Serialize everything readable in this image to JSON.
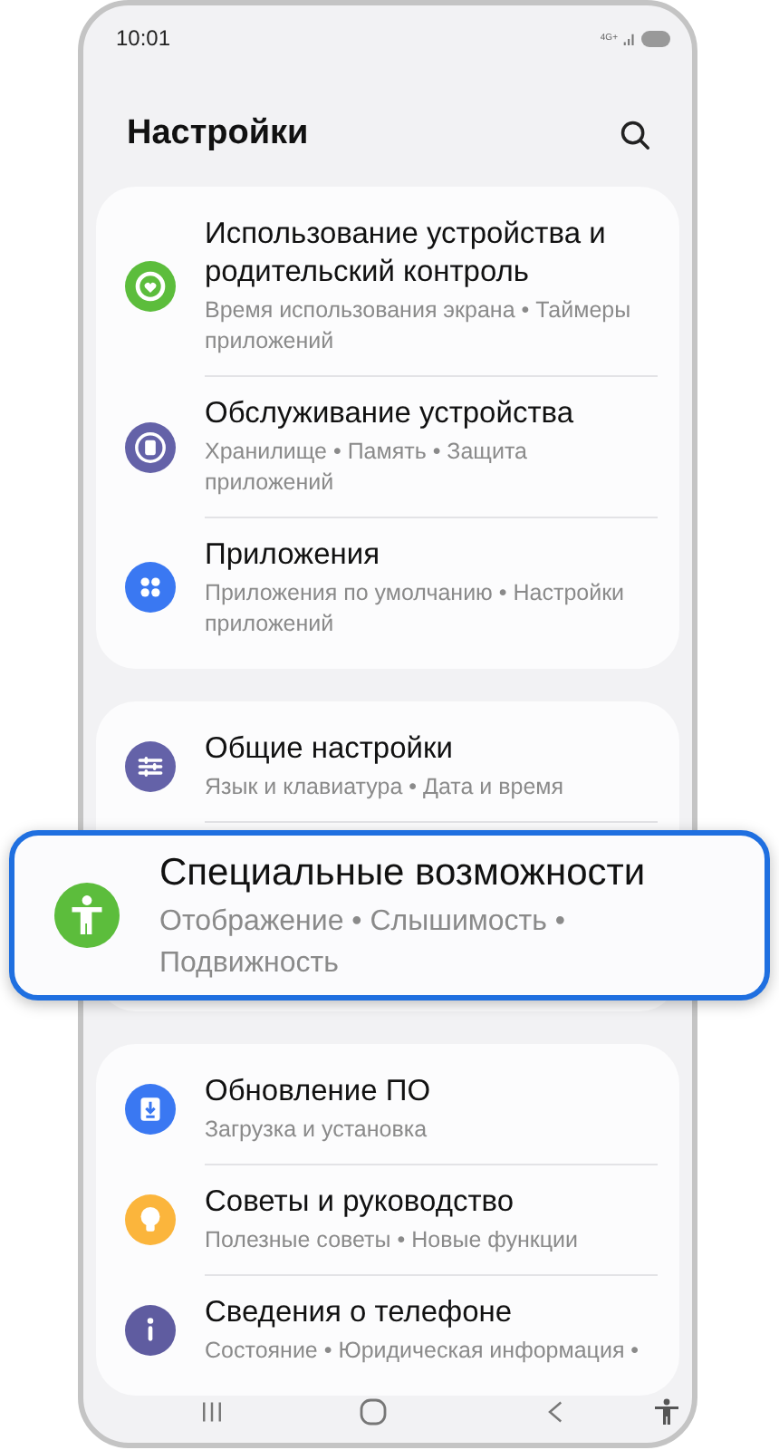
{
  "status_bar": {
    "time": "10:01",
    "network": "4G+"
  },
  "header": {
    "title": "Настройки"
  },
  "groups": [
    {
      "items": [
        {
          "title": "Использование устройства и родительский контроль",
          "subtitle": "Время использования экрана • Таймеры приложений",
          "color": "#5cbd3c",
          "highlighted": false
        },
        {
          "title": "Обслуживание устройства",
          "subtitle": "Хранилище • Память • Защита приложений",
          "color": "#6462a8",
          "highlighted": false
        },
        {
          "title": "Приложения",
          "subtitle": "Приложения по умолчанию • Настройки приложений",
          "color": "#3a78f2",
          "highlighted": false
        }
      ]
    },
    {
      "items": [
        {
          "title": "Общие настройки",
          "subtitle": "Язык и клавиатура • Дата и время",
          "color": "#6462a8",
          "highlighted": false
        },
        {
          "title": "Специальные возможности",
          "subtitle": "Отображение • Слышимость • Подвижность",
          "color": "#5cbd3c",
          "highlighted": true
        }
      ]
    },
    {
      "items": [
        {
          "title": "Обновление ПО",
          "subtitle": "Загрузка и установка",
          "color": "#3a78f2",
          "highlighted": false
        },
        {
          "title": "Советы и руководство",
          "subtitle": "Полезные советы • Новые функции",
          "color": "#fbb53c",
          "highlighted": false
        },
        {
          "title": "Сведения о телефоне",
          "subtitle": "Состояние • Юридическая информация •",
          "color": "#5f5ca0",
          "highlighted": false
        }
      ]
    }
  ]
}
